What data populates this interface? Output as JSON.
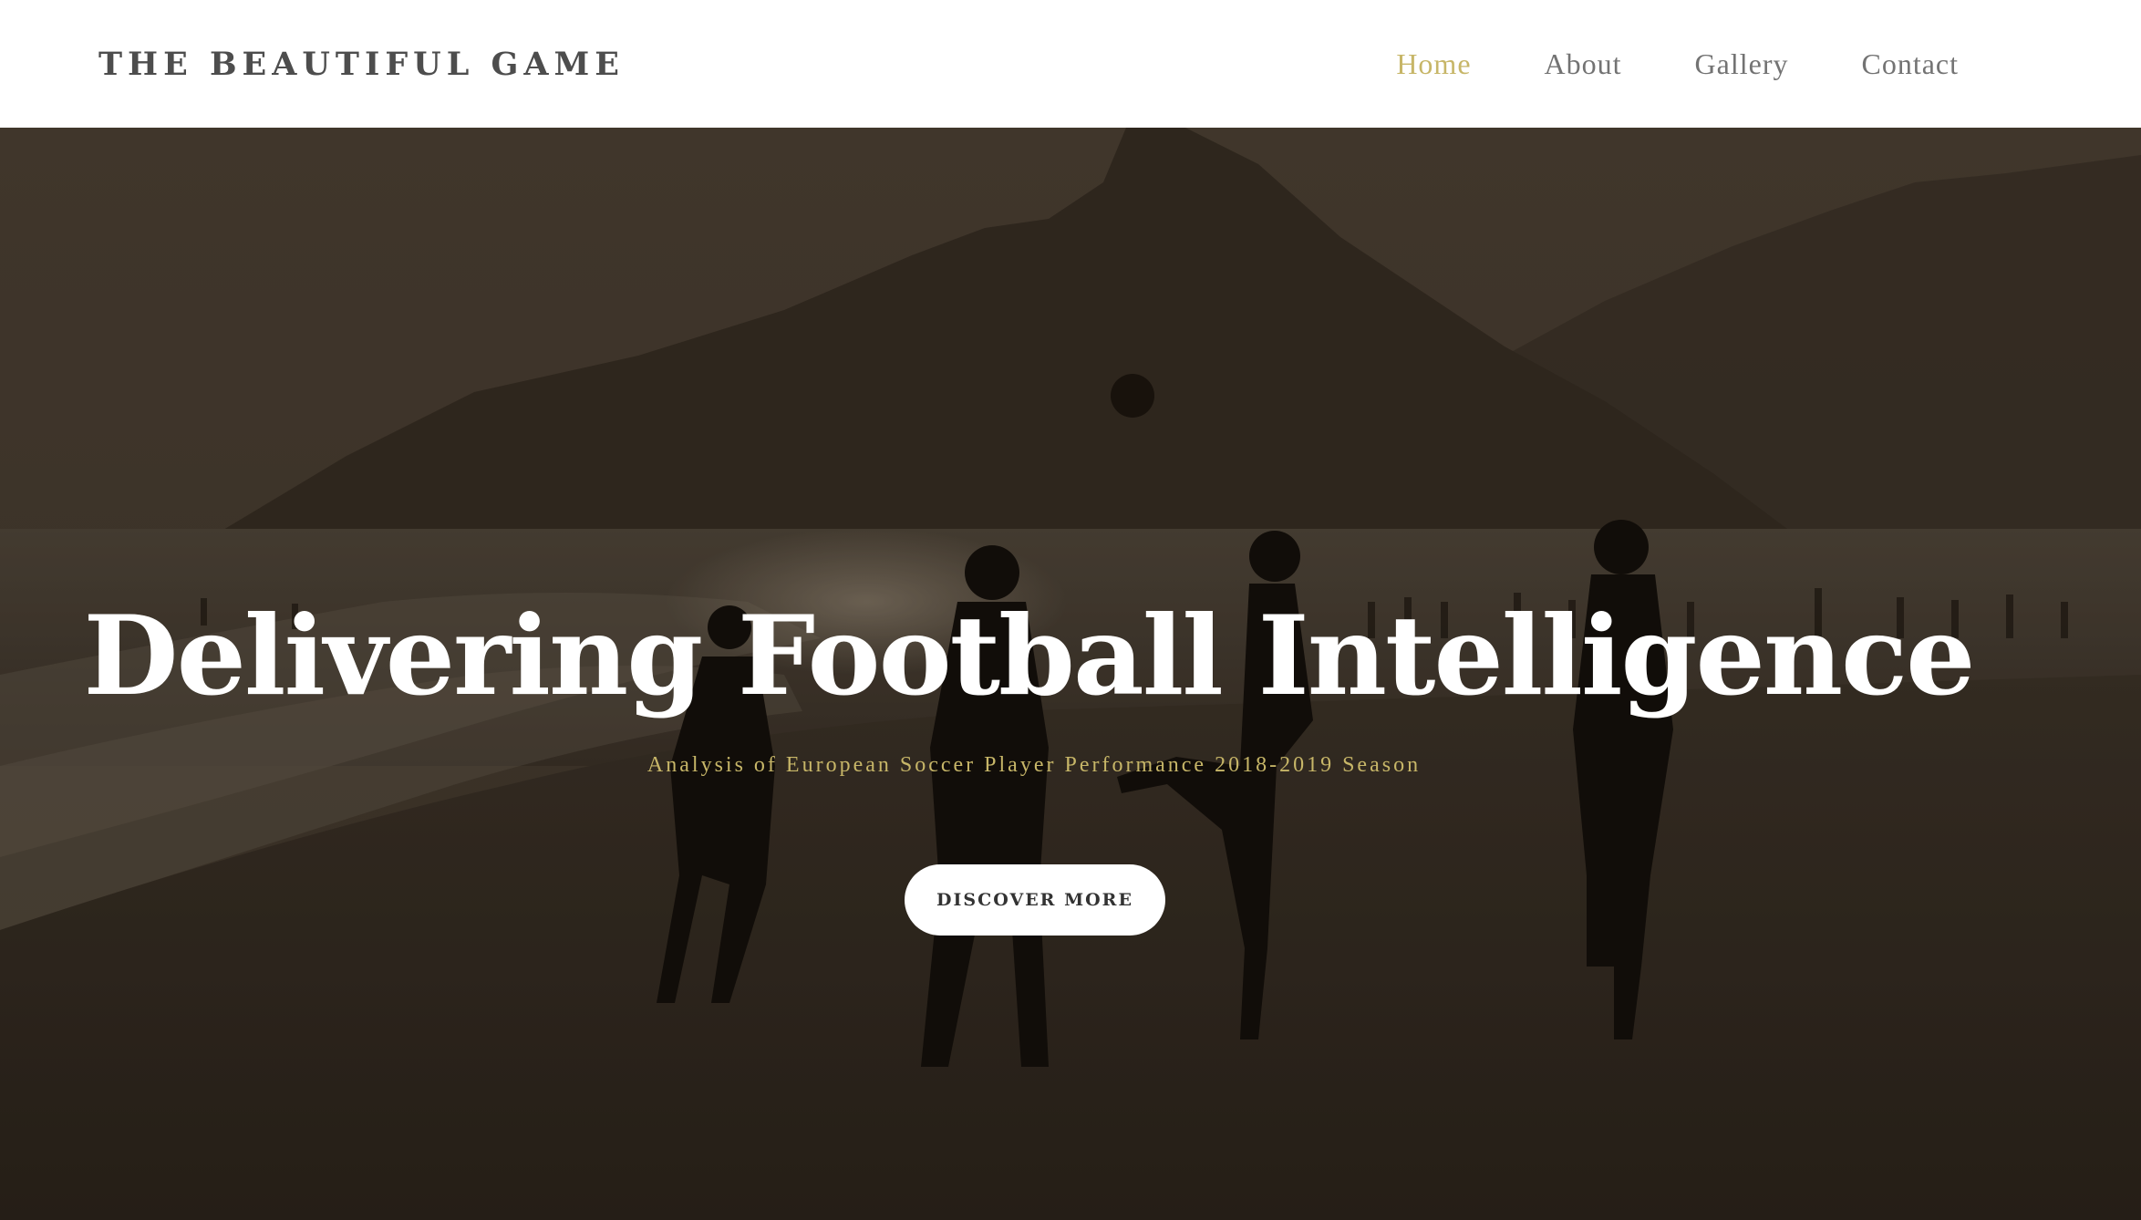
{
  "navbar": {
    "brand": "THE BEAUTIFUL GAME",
    "links": [
      {
        "label": "Home",
        "active": true
      },
      {
        "label": "About",
        "active": false
      },
      {
        "label": "Gallery",
        "active": false
      },
      {
        "label": "Contact",
        "active": false
      }
    ]
  },
  "hero": {
    "title": "Delivering Football Intelligence",
    "subtitle": "Analysis of European Soccer Player Performance 2018-2019 Season",
    "cta_label": "DISCOVER MORE"
  },
  "colors": {
    "accent": "#c7b668",
    "nav_text": "#737373",
    "brand_text": "#4d4d4d",
    "hero_text": "#ffffff"
  }
}
